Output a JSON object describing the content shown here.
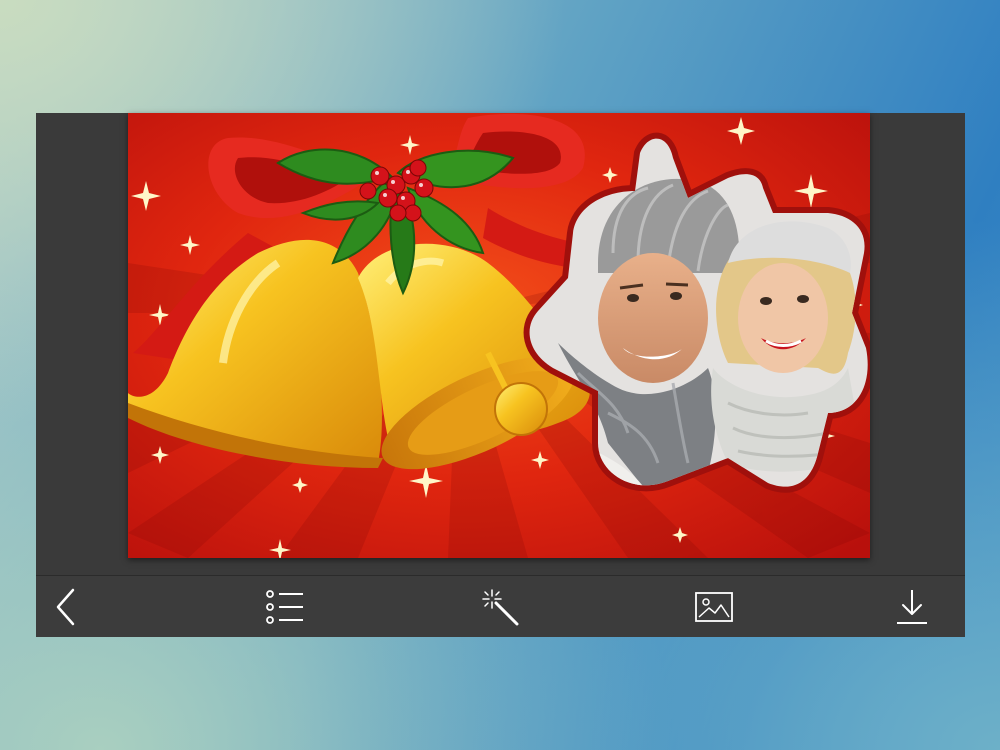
{
  "app": {
    "screen": "photo-frame-editor"
  },
  "frame": {
    "theme": "christmas-bells-star-frame",
    "colors": {
      "background_red": "#d8180f",
      "bell_gold": "#f2b21a",
      "ribbon_red": "#e0201c",
      "holly_green": "#2f8a1e",
      "berry_red": "#d4121a"
    }
  },
  "toolbar": {
    "items": [
      {
        "id": "back",
        "icon": "chevron-left-icon"
      },
      {
        "id": "frames",
        "icon": "list-icon"
      },
      {
        "id": "effects",
        "icon": "magic-wand-icon"
      },
      {
        "id": "gallery",
        "icon": "image-icon"
      },
      {
        "id": "save",
        "icon": "download-icon"
      }
    ],
    "icon_color": "#ffffff",
    "background": "#3c3c3c"
  }
}
